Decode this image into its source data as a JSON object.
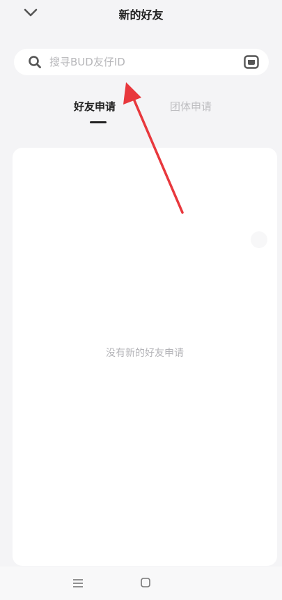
{
  "header": {
    "title": "新的好友",
    "back_icon": "chevron-down-icon"
  },
  "search": {
    "placeholder": "搜寻BUD友仔ID",
    "value": "",
    "scan_icon": "scan-icon"
  },
  "tabs": [
    {
      "label": "好友申请",
      "active": true
    },
    {
      "label": "团体申请",
      "active": false
    }
  ],
  "content": {
    "empty_message": "没有新的好友申请"
  },
  "bottom_nav": {
    "items": [
      "menu-icon",
      "home-icon"
    ]
  },
  "colors": {
    "background": "#f4f4f6",
    "panel": "#ffffff",
    "annotation_arrow": "#e8383d",
    "active_tab": "#222222",
    "inactive_tab": "#bdbdc0"
  }
}
